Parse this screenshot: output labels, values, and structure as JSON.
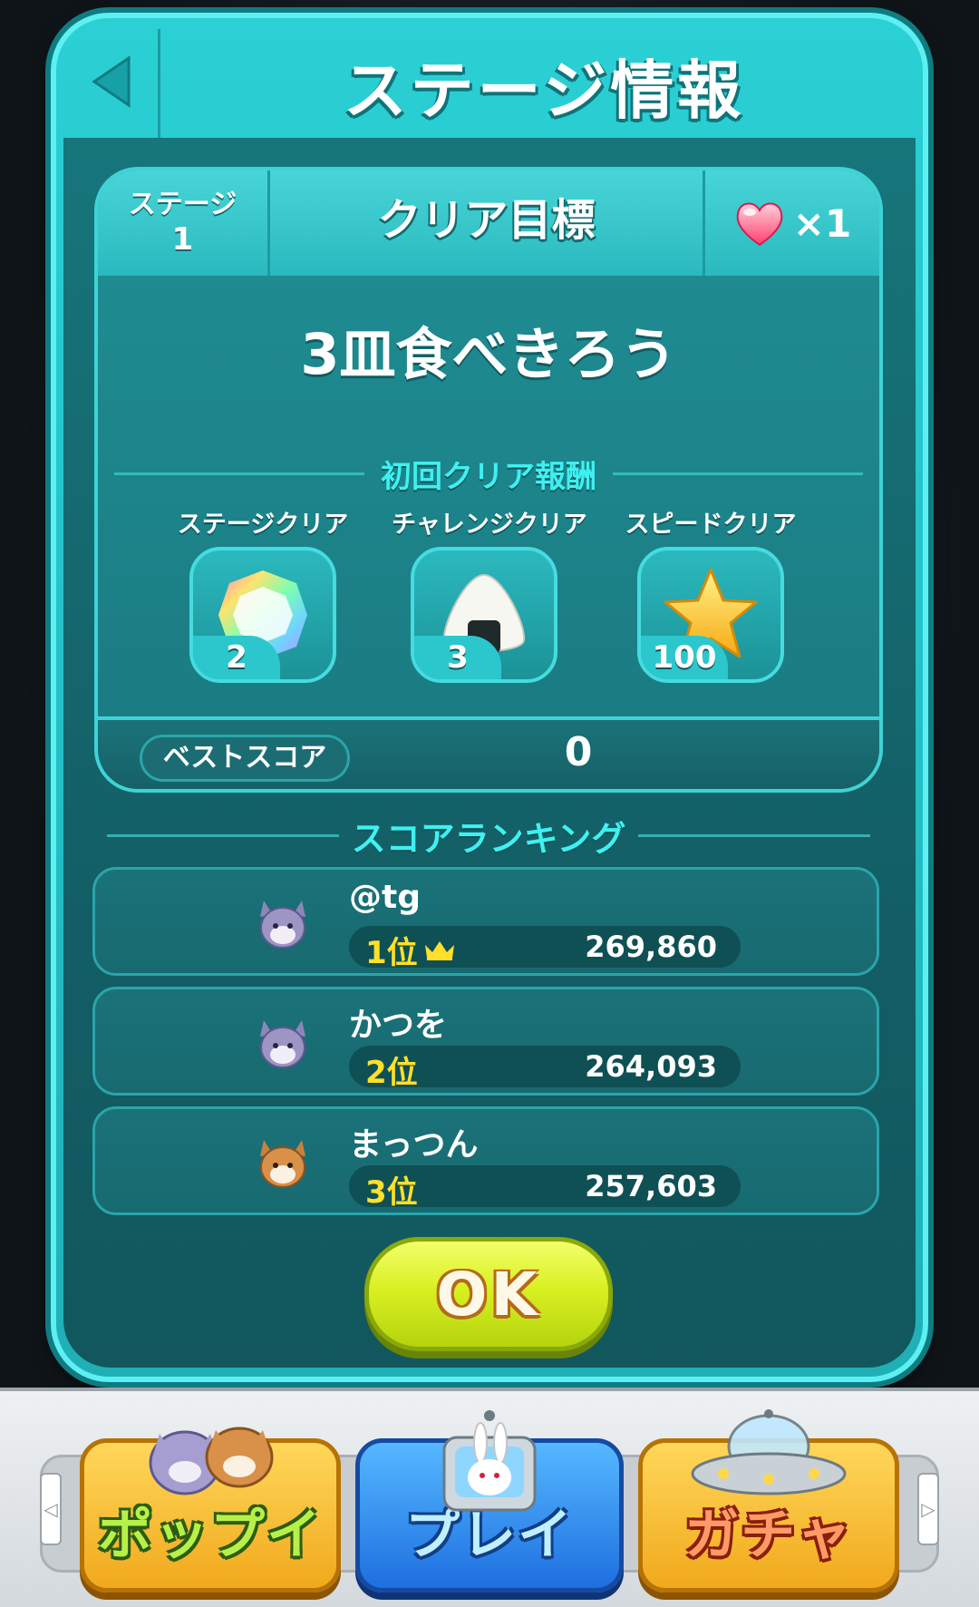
{
  "modal": {
    "title": "ステージ情報",
    "back_icon": "back-arrow-icon"
  },
  "stage_card": {
    "stage_label": "ステージ",
    "stage_number": "1",
    "goal_header": "クリア目標",
    "life_icon": "heart-icon",
    "life_cost": "×1",
    "goal_text": "3皿食べきろう",
    "rewards_heading": "初回クリア報酬",
    "rewards": [
      {
        "label": "ステージクリア",
        "icon": "rainbow-gem-icon",
        "count": "2"
      },
      {
        "label": "チャレンジクリア",
        "icon": "rice-ball-icon",
        "count": "3"
      },
      {
        "label": "スピードクリア",
        "icon": "star-icon",
        "count": "100"
      }
    ],
    "best_score_label": "ベストスコア",
    "best_score_value": "0"
  },
  "ranking": {
    "heading": "スコアランキング",
    "rows": [
      {
        "name": "@tg",
        "position": "1位",
        "crown_icon": "crown-icon",
        "score": "269,860",
        "avatar": "gray-cat-avatar"
      },
      {
        "name": "かつを",
        "position": "2位",
        "score": "264,093",
        "avatar": "gray-cat-avatar"
      },
      {
        "name": "まっつん",
        "position": "3位",
        "score": "257,603",
        "avatar": "shiba-dog-avatar"
      }
    ]
  },
  "ok_button": "OK",
  "bottom_nav": {
    "poppy": "ポップイ",
    "play": "プレイ",
    "gacha": "ガチャ"
  },
  "colors": {
    "modal_teal": "#2ad0d4",
    "panel_dark_teal": "#135f66",
    "heading_cyan": "#3ff0f0",
    "rank_yellow": "#ffe02a",
    "ok_yellow_green": "#d9f022"
  }
}
